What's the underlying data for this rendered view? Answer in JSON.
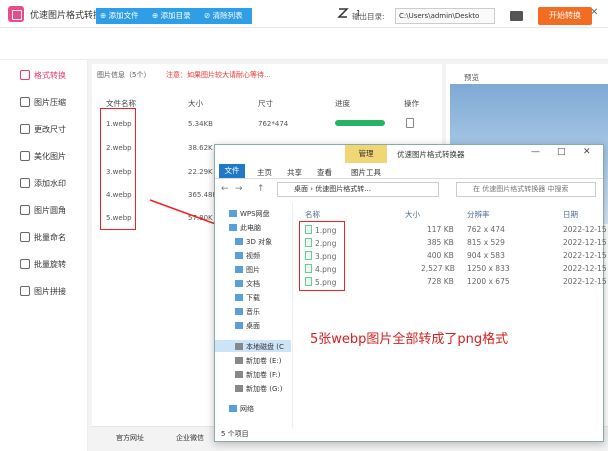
{
  "app": {
    "title": "优速图片格式转换器",
    "counter": "1",
    "win_buttons": [
      "—",
      "□",
      "✕"
    ]
  },
  "toolbar": {
    "add_file": "添加文件",
    "add_dir": "添加目录",
    "clear_list": "清除列表",
    "output_label": "输出目录:",
    "output_path": "C:\\Users\\admin\\Deskto",
    "start": "开始转换"
  },
  "sidebar": {
    "items": [
      "格式转换",
      "图片压缩",
      "更改尺寸",
      "美化图片",
      "添加水印",
      "图片圆角",
      "批量命名",
      "批量旋转",
      "图片拼接"
    ],
    "active_index": 0
  },
  "file_panel": {
    "info_label": "图片信息（5个）",
    "warning": "注意：如果图片较大请耐心等待...",
    "columns": [
      "文件名称",
      "大小",
      "尺寸",
      "进度",
      "操作"
    ],
    "rows": [
      {
        "name": "1.webp",
        "size": "5.34KB",
        "dim": "762*474"
      },
      {
        "name": "2.webp",
        "size": "38.62K",
        "dim": ""
      },
      {
        "name": "3.webp",
        "size": "22.29K",
        "dim": ""
      },
      {
        "name": "4.webp",
        "size": "365.48K",
        "dim": ""
      },
      {
        "name": "5.webp",
        "size": "57.80K",
        "dim": ""
      }
    ],
    "progress": 1.0
  },
  "preview": {
    "label": "预览"
  },
  "footer": {
    "website": "官方网址",
    "wechat": "企业微信"
  },
  "explorer": {
    "title": "优速图片格式转换器",
    "manage": "管理",
    "ribbon": [
      "文件",
      "主页",
      "共享",
      "查看",
      "图片工具"
    ],
    "nav": [
      "←",
      "→",
      "↑"
    ],
    "address": [
      "桌面",
      "优速图片格式转..."
    ],
    "search_placeholder": "在 优速图片格式转换器 中搜索",
    "tree": [
      "WPS网盘",
      "此电脑",
      "3D 对象",
      "视频",
      "图片",
      "文档",
      "下载",
      "音乐",
      "桌面",
      "本地磁盘 (C",
      "新加卷 (E:)",
      "新加卷 (F:)",
      "新加卷 (G:)",
      "网络"
    ],
    "columns": [
      "名称",
      "大小",
      "分辨率",
      "日期"
    ],
    "files": [
      {
        "name": "1.png",
        "size": "117 KB",
        "res": "762 x 474",
        "date": "2022-12-15"
      },
      {
        "name": "2.png",
        "size": "385 KB",
        "res": "815 x 529",
        "date": "2022-12-15"
      },
      {
        "name": "3.png",
        "size": "400 KB",
        "res": "904 x 583",
        "date": "2022-12-15"
      },
      {
        "name": "4.png",
        "size": "2,527 KB",
        "res": "1250 x 833",
        "date": "2022-12-15"
      },
      {
        "name": "5.png",
        "size": "728 KB",
        "res": "1200 x 675",
        "date": "2022-12-15"
      }
    ],
    "status": "5 个项目"
  },
  "annotation": "5张webp图片全部转成了png格式",
  "colors": {
    "accent_blue": "#2e9fe6",
    "start_orange": "#f36c21",
    "active_pink": "#e63c6e",
    "highlight_red": "#e22222"
  }
}
